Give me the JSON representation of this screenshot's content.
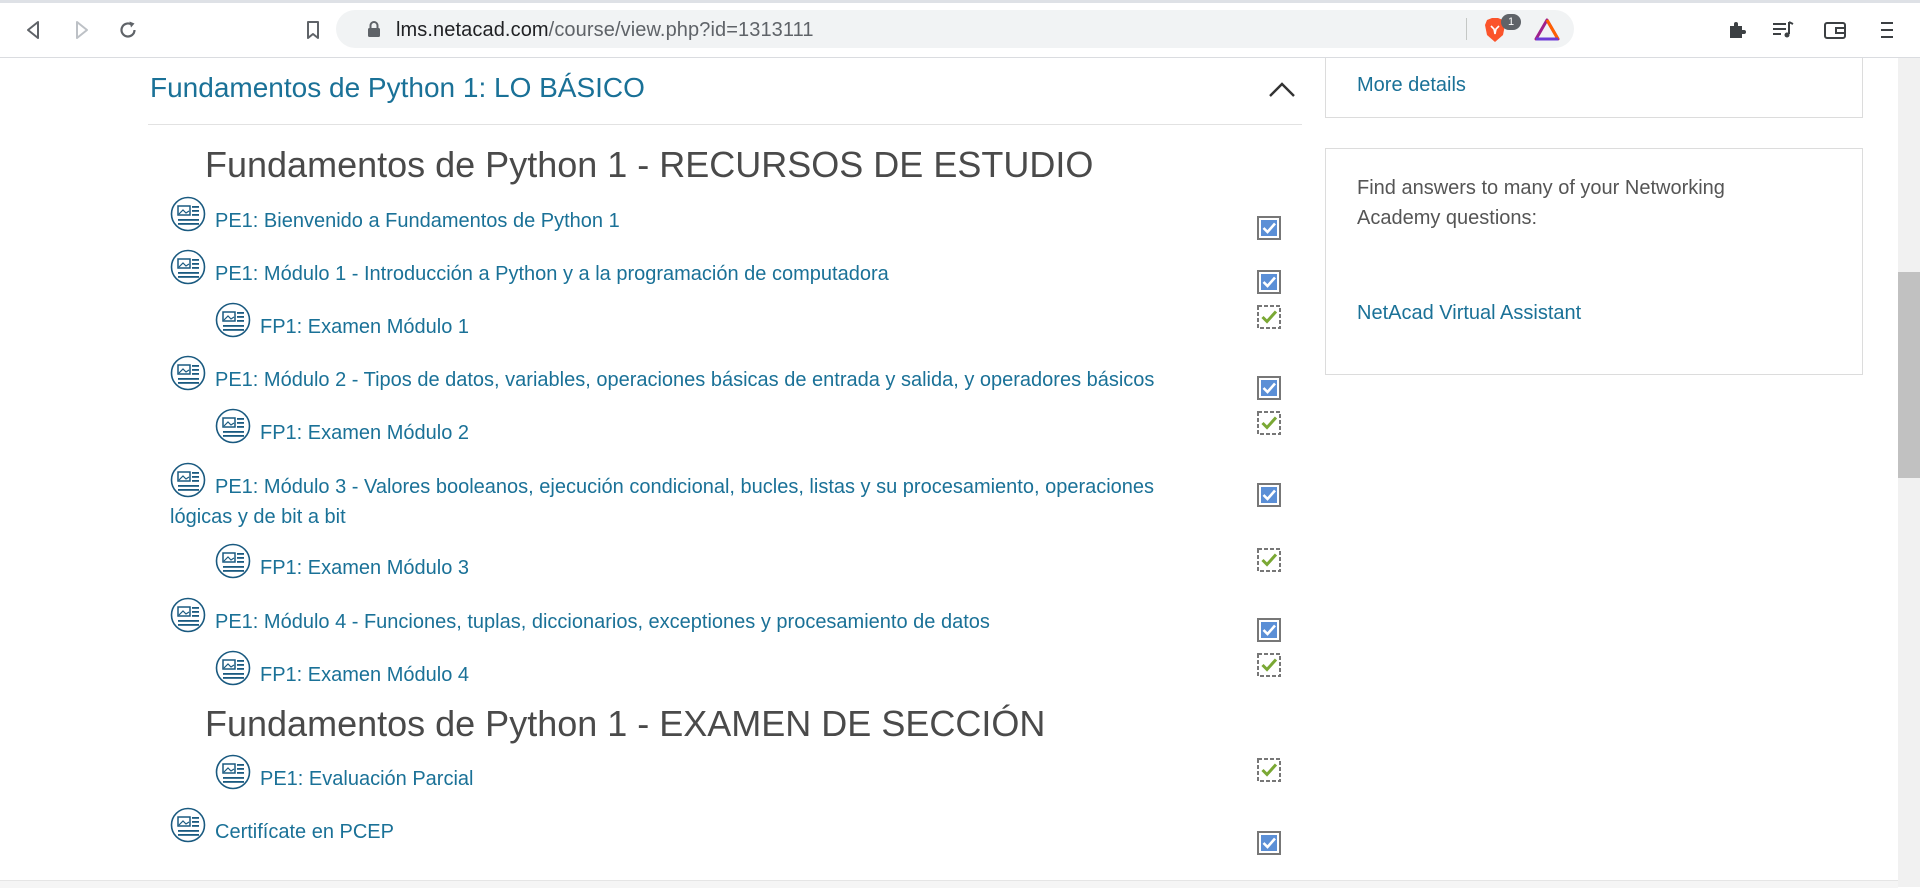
{
  "browser": {
    "url_host": "lms.netacad.com",
    "url_path": "/course/view.php?id=1313111",
    "brave_badge_count": "1"
  },
  "course": {
    "section_heading": "Fundamentos de Python 1: LO BÁSICO",
    "study_resources_title": "Fundamentos de Python 1 - RECURSOS DE ESTUDIO",
    "exam_section_title": "Fundamentos de Python 1 - EXAMEN DE SECCIÓN",
    "items": [
      {
        "label": "PE1: Bienvenido a Fundamentos de Python 1",
        "level": 0,
        "completion": "manual-checked"
      },
      {
        "label": "PE1: Módulo 1 - Introducción a Python y a la programación de computadora",
        "level": 0,
        "completion": "manual-checked"
      },
      {
        "label": "FP1: Examen Módulo 1",
        "level": 1,
        "completion": "auto-checked"
      },
      {
        "label": "PE1: Módulo 2 - Tipos de datos, variables, operaciones básicas de entrada y salida, y operadores básicos",
        "level": 0,
        "completion": "manual-checked"
      },
      {
        "label": "FP1: Examen Módulo 2",
        "level": 1,
        "completion": "auto-checked"
      },
      {
        "label": "PE1: Módulo 3 - Valores booleanos, ejecución condicional, bucles, listas y su procesamiento, operaciones lógicas y de bit a bit",
        "level": 0,
        "completion": "manual-checked"
      },
      {
        "label": "FP1: Examen Módulo 3",
        "level": 1,
        "completion": "auto-checked"
      },
      {
        "label": "PE1: Módulo 4 - Funciones, tuplas, diccionarios, exceptiones y procesamiento de datos",
        "level": 0,
        "completion": "manual-checked"
      },
      {
        "label": "FP1: Examen Módulo 4",
        "level": 1,
        "completion": "auto-checked"
      },
      {
        "label": "PE1: Evaluación Parcial",
        "level": 1,
        "completion": "auto-checked"
      },
      {
        "label": "Certifícate en PCEP",
        "level": 0,
        "completion": "manual-checked"
      }
    ]
  },
  "sidebar": {
    "more_details": "More details",
    "help_text": "Find answers to many of your Networking Academy questions:",
    "assistant_link": "NetAcad Virtual Assistant"
  },
  "colors": {
    "link": "#1a7197",
    "heading": "#4a4a4a",
    "check_manual": "#5b8fd6",
    "check_auto": "#7aa834"
  }
}
